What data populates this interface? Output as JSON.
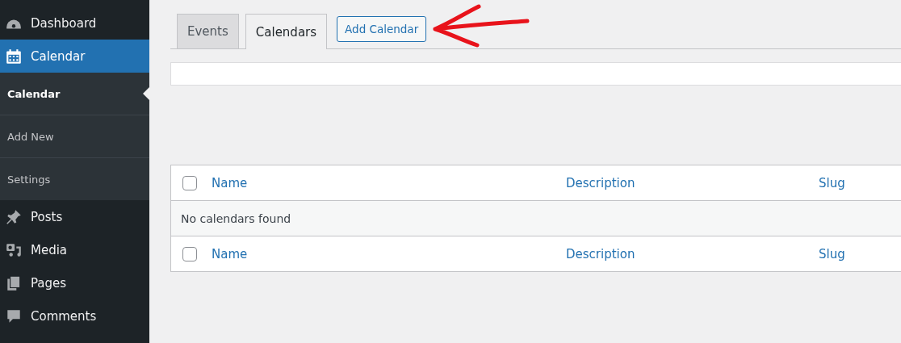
{
  "sidebar": {
    "items": [
      {
        "label": "Dashboard",
        "selected": false
      },
      {
        "label": "Calendar",
        "selected": true,
        "children": [
          {
            "label": "Calendar",
            "selected": true
          },
          {
            "label": "Add New",
            "selected": false
          },
          {
            "label": "Settings",
            "selected": false
          }
        ]
      },
      {
        "label": "Posts",
        "selected": false
      },
      {
        "label": "Media",
        "selected": false
      },
      {
        "label": "Pages",
        "selected": false
      },
      {
        "label": "Comments",
        "selected": false
      }
    ]
  },
  "tabs": [
    {
      "label": "Events",
      "selected": false
    },
    {
      "label": "Calendars",
      "selected": true
    }
  ],
  "add_button": "Add Calendar",
  "table": {
    "columns": [
      "Name",
      "Description",
      "Slug"
    ],
    "footer_columns": [
      "Name",
      "Description",
      "Slug"
    ],
    "header_checked": false,
    "footer_checked": false,
    "empty_message": "No calendars found"
  }
}
